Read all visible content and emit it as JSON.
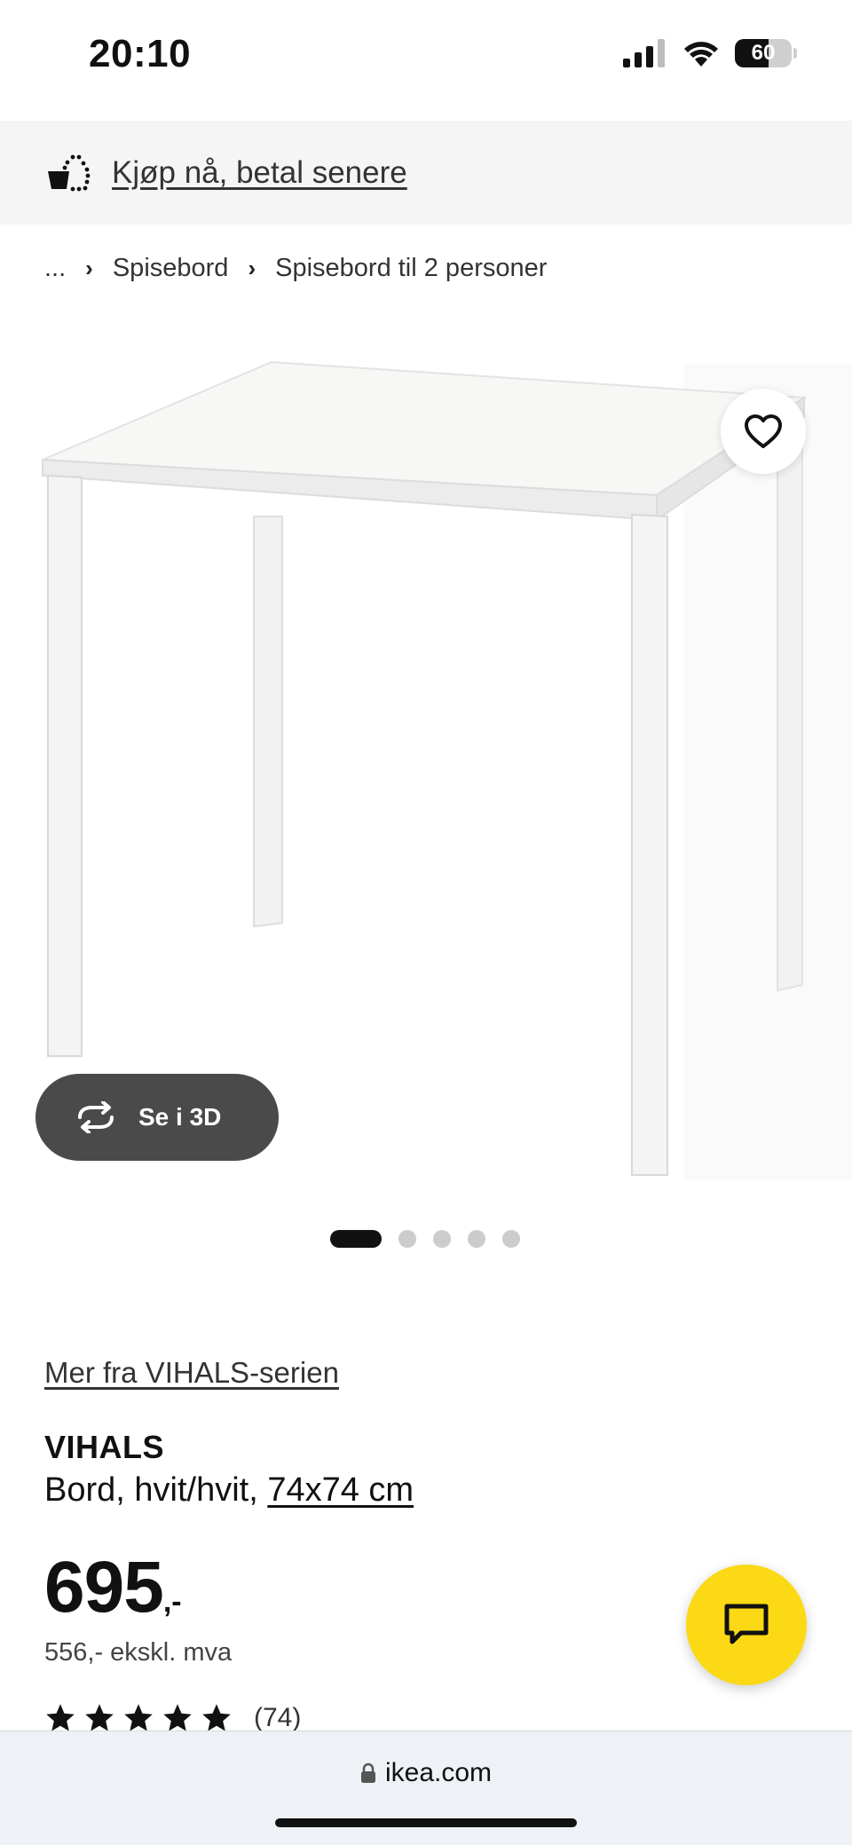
{
  "status_bar": {
    "time": "20:10",
    "battery": "60",
    "battery_level": 0.6
  },
  "promo": {
    "icon": "basket-dots-icon",
    "link_text": "Kjøp nå, betal senere"
  },
  "breadcrumb": {
    "ellipsis": "...",
    "items": [
      "Spisebord",
      "Spisebord til 2 personer"
    ]
  },
  "gallery": {
    "wishlist_icon": "heart-icon",
    "view_3d_label": "Se i 3D",
    "view_3d_icon": "rotate-arrows-icon",
    "dots_total": 5,
    "active_index": 0
  },
  "product": {
    "series_link": "Mer fra VIHALS-serien",
    "name": "VIHALS",
    "description": "Bord, hvit/hvit, ",
    "size": "74x74 cm",
    "price": "695",
    "price_suffix": ",-",
    "price_ex_vat": "556,- ekskl. mva",
    "rating_stars": 5,
    "review_count": "(74)"
  },
  "chat": {
    "icon": "chat-bubble-icon"
  },
  "browser": {
    "url": "ikea.com",
    "lock_icon": "lock-icon"
  }
}
